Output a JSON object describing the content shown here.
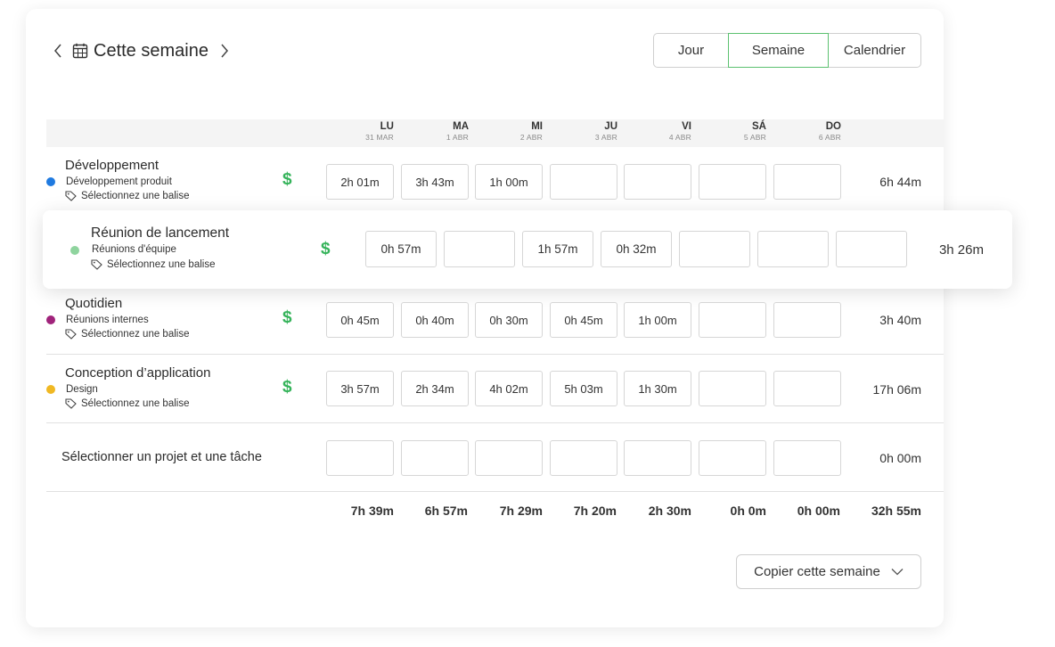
{
  "header": {
    "week_title": "Cette semaine",
    "prev_icon": "chevron-left-icon",
    "next_icon": "chevron-right-icon",
    "calendar_icon": "calendar-icon"
  },
  "views": {
    "day": "Jour",
    "week": "Semaine",
    "calendar": "Calendrier",
    "active": "Semaine"
  },
  "days": [
    {
      "d": "LU",
      "date": "31 MAR"
    },
    {
      "d": "MA",
      "date": "1 ABR"
    },
    {
      "d": "MI",
      "date": "2 ABR"
    },
    {
      "d": "JU",
      "date": "3 ABR"
    },
    {
      "d": "VI",
      "date": "4 ABR"
    },
    {
      "d": "SÁ",
      "date": "5 ABR"
    },
    {
      "d": "DO",
      "date": "6 ABR"
    }
  ],
  "rows": [
    {
      "project": "Développement",
      "task": "Développement produit",
      "tag": "Sélectionnez une balise",
      "color": "#1f7ae0",
      "billable": "$",
      "times": [
        "2h 01m",
        "3h 43m",
        "1h 00m",
        "",
        "",
        "",
        ""
      ],
      "total": "6h 44m"
    },
    {
      "project": "Réunion de lancement",
      "task": "Réunions d'équipe",
      "tag": "Sélectionnez une balise",
      "color": "#8fd49e",
      "billable": "$",
      "times": [
        "0h 57m",
        "",
        "1h 57m",
        "0h 32m",
        "",
        "",
        ""
      ],
      "total": "3h 26m"
    },
    {
      "project": "Quotidien",
      "task": "Réunions internes",
      "tag": "Sélectionnez une balise",
      "color": "#a0237b",
      "billable": "$",
      "times": [
        "0h 45m",
        "0h 40m",
        "0h 30m",
        "0h 45m",
        "1h 00m",
        "",
        ""
      ],
      "total": "3h 40m"
    },
    {
      "project": "Conception d’application",
      "task": "Design",
      "tag": "Sélectionnez une balise",
      "color": "#f0b823",
      "billable": "$",
      "times": [
        "3h 57m",
        "2h 34m",
        "4h 02m",
        "5h 03m",
        "1h 30m",
        "",
        ""
      ],
      "total": "17h 06m"
    }
  ],
  "new_row": {
    "label": "Sélectionner un projet et une tâche",
    "total": "0h 00m"
  },
  "totals": [
    "7h 39m",
    "6h 57m",
    "7h 29m",
    "7h 20m",
    "2h 30m",
    "0h 0m",
    "0h 00m"
  ],
  "grand_total": "32h 55m",
  "copy_week": "Copier cette semaine",
  "accent": "#5cc170",
  "billable_color": "#35b35a"
}
